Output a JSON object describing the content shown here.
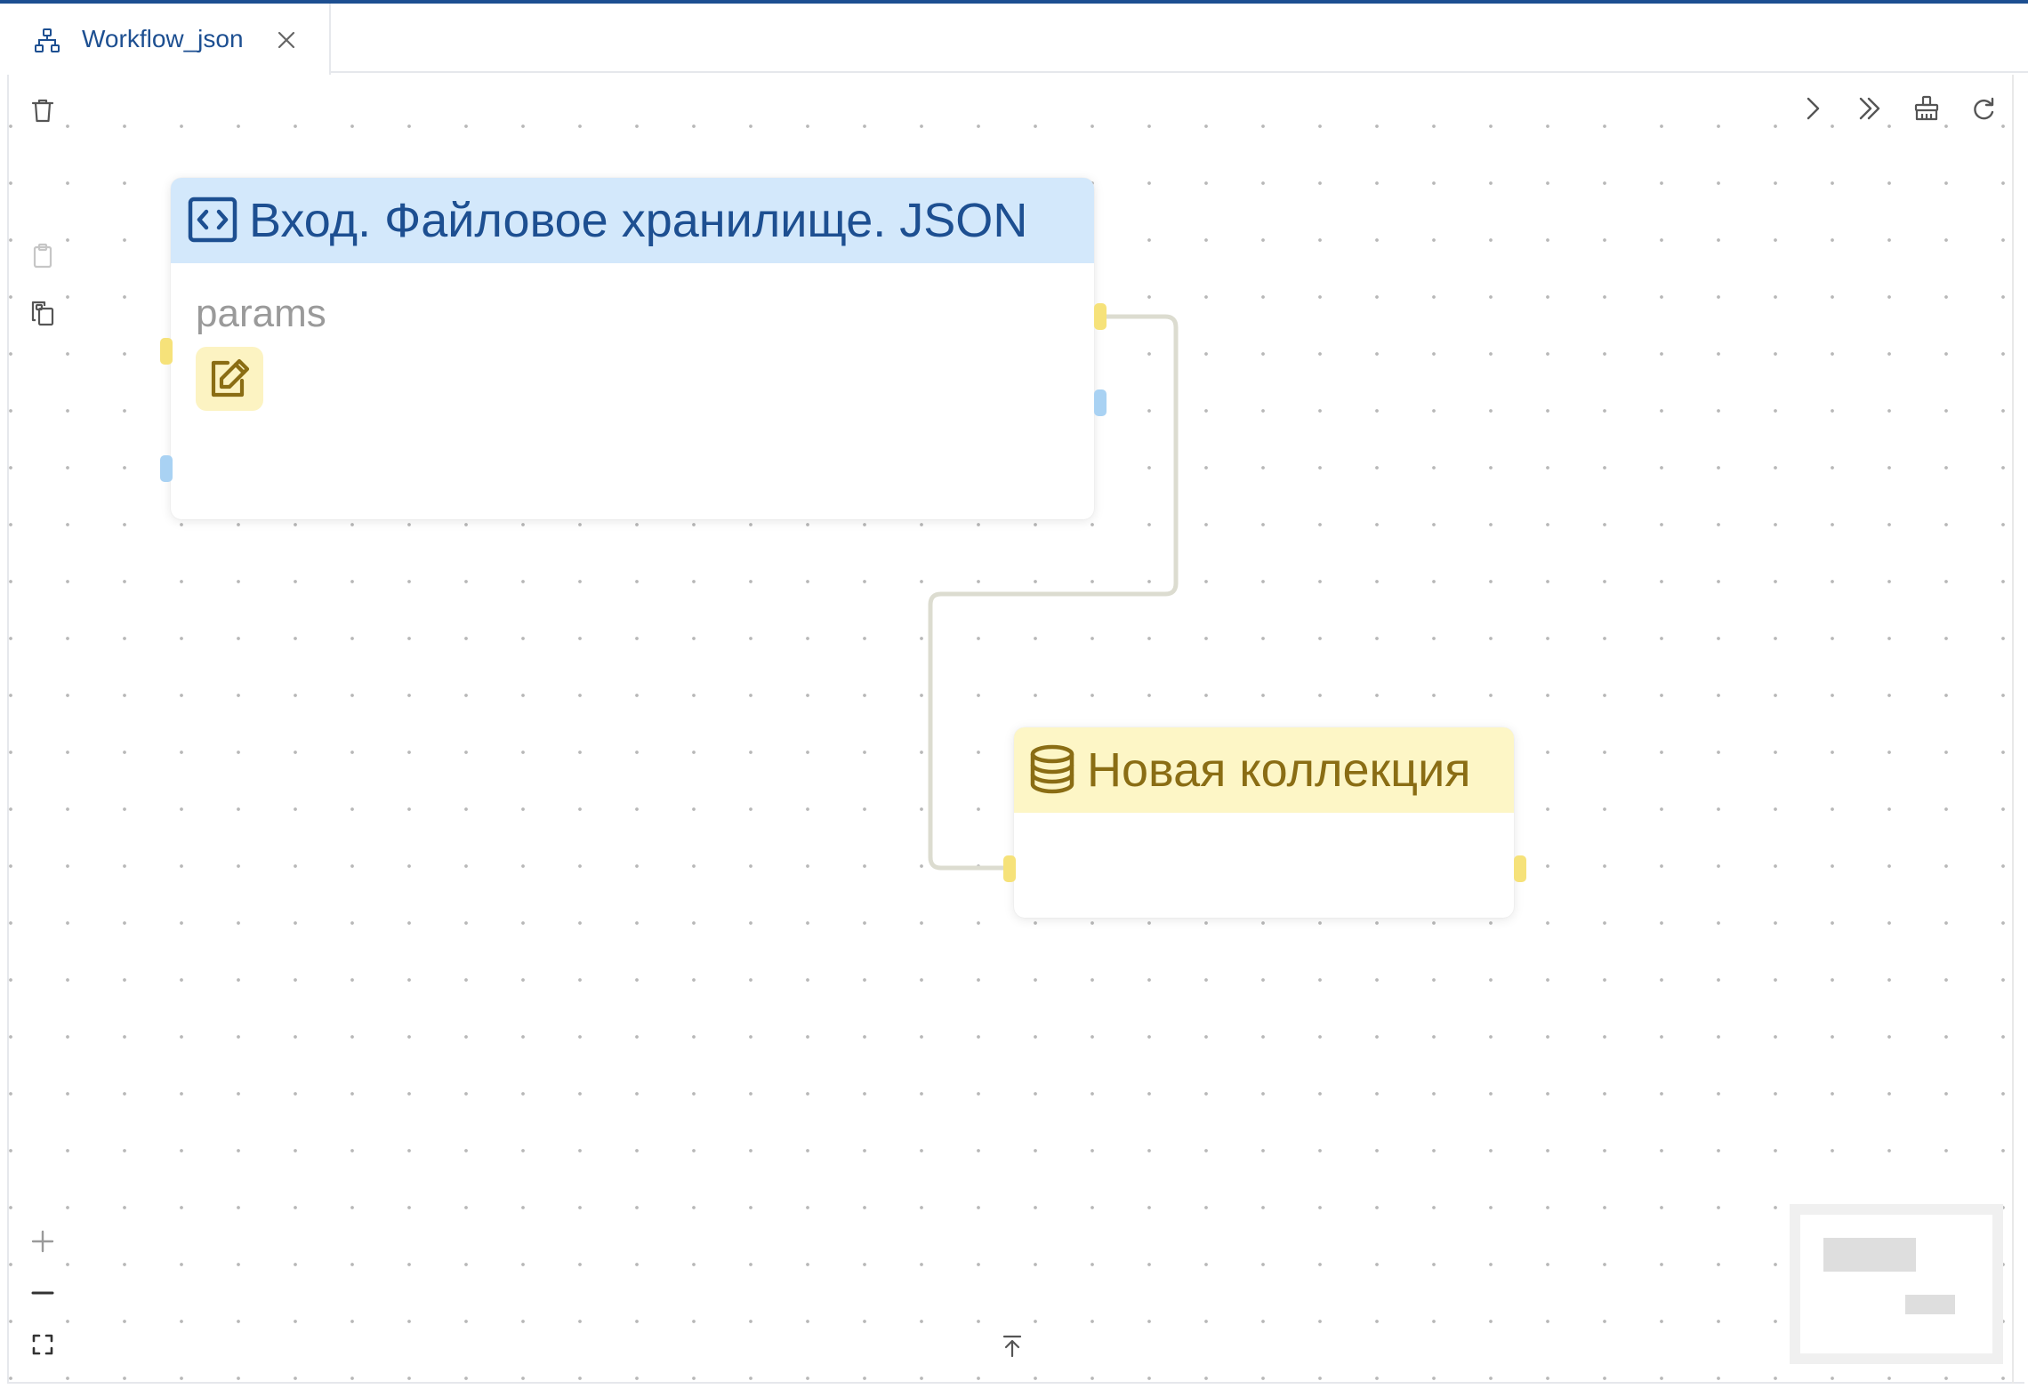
{
  "tab": {
    "label": "Workflow_json",
    "icon": "workflow-icon",
    "close_icon": "close-icon"
  },
  "toolbar_left": {
    "delete_icon": "trash-icon",
    "paste_icon": "clipboard-icon",
    "duplicate_icon": "copy-icon"
  },
  "toolbar_right": {
    "run_icon": "chevron-right-icon",
    "run_all_icon": "double-chevron-right-icon",
    "clear_icon": "broom-icon",
    "refresh_icon": "refresh-icon"
  },
  "zoom_controls": {
    "zoom_in_icon": "plus-icon",
    "zoom_out_icon": "minus-icon",
    "fit_icon": "fit-view-icon"
  },
  "bottom_center": {
    "icon": "arrow-up-to-line-icon"
  },
  "nodes": [
    {
      "title": "Вход. Файловое хранилище. JSON",
      "icon": "code-icon",
      "header_color": "#d3e8fb",
      "title_color": "#1d4f91",
      "param_label": "params",
      "edit_icon": "edit-icon"
    },
    {
      "title": "Новая коллекция",
      "icon": "database-icon",
      "header_color": "#fdf6c6",
      "title_color": "#8a6d14"
    }
  ],
  "connection": {
    "from": "Вход. Файловое хранилище. JSON",
    "to": "Новая коллекция",
    "color": "#dcdcd0"
  },
  "colors": {
    "accent": "#1d4f91",
    "port_yellow": "#f6e27a",
    "port_blue": "#a9d2f3"
  }
}
